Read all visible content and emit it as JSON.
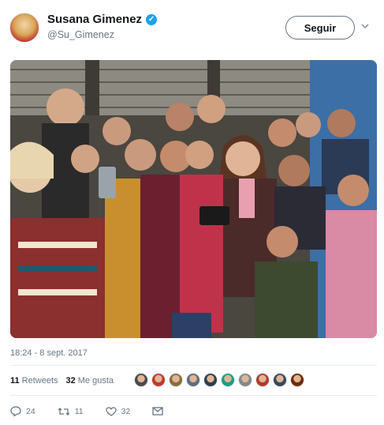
{
  "header": {
    "display_name": "Susana Gimenez",
    "handle": "@Su_Gimenez",
    "verified": true,
    "follow_label": "Seguir"
  },
  "photo": {
    "subject": "group-selfie"
  },
  "tweet": {
    "timestamp": "18:24 - 8 sept. 2017"
  },
  "stats": {
    "retweets_count": "11",
    "retweets_label": "Retweets",
    "likes_count": "32",
    "likes_label": "Me gusta",
    "liker_avatars": [
      "#4a4a4a",
      "#c0392b",
      "#8a6d3b",
      "#5d6d7e",
      "#2c3e50",
      "#16a085",
      "#7f8c8d",
      "#b03a2e",
      "#34495e",
      "#6e2c00"
    ]
  },
  "actions": {
    "reply_count": "24",
    "retweet_count": "11",
    "like_count": "32"
  },
  "colors": {
    "accent": "#1da1f2",
    "muted": "#657786",
    "text": "#14171a"
  }
}
